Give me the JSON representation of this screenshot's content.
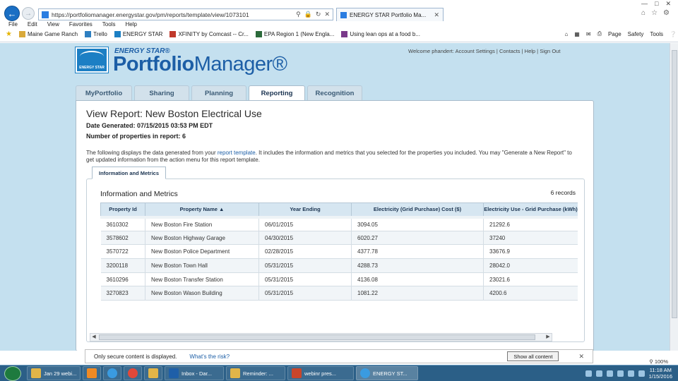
{
  "browser": {
    "url": "https://portfoliomanager.energystar.gov/pm/reports/template/view/1073101",
    "tab_title": "ENERGY STAR Portfolio Ma...",
    "menu": [
      "File",
      "Edit",
      "View",
      "Favorites",
      "Tools",
      "Help"
    ],
    "favorites": [
      "Maine Game Ranch",
      "Trello",
      "ENERGY STAR",
      "XFINITY by Comcast -- Cr...",
      "EPA Region 1 (New Engla...",
      "Using lean ops at a food b..."
    ],
    "toolbar_right": [
      "Page",
      "Safety",
      "Tools"
    ]
  },
  "header": {
    "logo_text": "ENERGY STAR",
    "brand_small": "ENERGY STAR®",
    "brand_portfolio": "Portfolio",
    "brand_manager": "Manager®",
    "welcome": "Welcome phandert: Account Settings | Contacts | Help | Sign Out"
  },
  "tabs": [
    "MyPortfolio",
    "Sharing",
    "Planning",
    "Reporting",
    "Recognition"
  ],
  "report": {
    "title": "View Report: New Boston Electrical Use",
    "date_generated": "Date Generated: 07/15/2015 03:53 PM EDT",
    "property_count": "Number of properties in report: 6",
    "desc_part1": "The following displays the data generated from your ",
    "desc_link": "report template",
    "desc_part2": ". It includes the information and metrics that you selected for the properties you included. You may \"Generate a New Report\" to get updated information from the action menu for this report template.",
    "subtab": "Information and Metrics",
    "section_title": "Information and Metrics",
    "records": "6 records"
  },
  "table": {
    "columns": [
      "Property Id",
      "Property Name ▲",
      "Year Ending",
      "Electricity (Grid Purchase) Cost ($)",
      "Electricity Use - Grid Purchase (kWh)"
    ],
    "rows": [
      [
        "3610302",
        "New Boston Fire Station",
        "06/01/2015",
        "3094.05",
        "21292.6"
      ],
      [
        "3578602",
        "New Boston Highway Garage",
        "04/30/2015",
        "6020.27",
        "37240"
      ],
      [
        "3570722",
        "New Boston Police Department",
        "02/28/2015",
        "4377.78",
        "33676.9"
      ],
      [
        "3200118",
        "New Boston Town Hall",
        "05/31/2015",
        "4288.73",
        "28042.0"
      ],
      [
        "3610296",
        "New Boston Transfer Station",
        "05/31/2015",
        "4136.08",
        "23021.6"
      ],
      [
        "3270823",
        "New Boston Wason Building",
        "05/31/2015",
        "1081.22",
        "4200.6"
      ]
    ]
  },
  "security": {
    "message": "Only secure content is displayed.",
    "link": "What's the risk?",
    "button": "Show all content"
  },
  "zoom": "100%",
  "taskbar": {
    "items": [
      "Jan 29 webi...",
      "Inbox - Dar...",
      "Reminder: ...",
      "webinr pres...",
      "ENERGY ST..."
    ],
    "time": "11:18 AM",
    "date": "1/15/2016"
  },
  "colors": {
    "accent": "#1c5ea6",
    "page_background": "#c4e0ef",
    "taskbar": "#2b5f87"
  }
}
